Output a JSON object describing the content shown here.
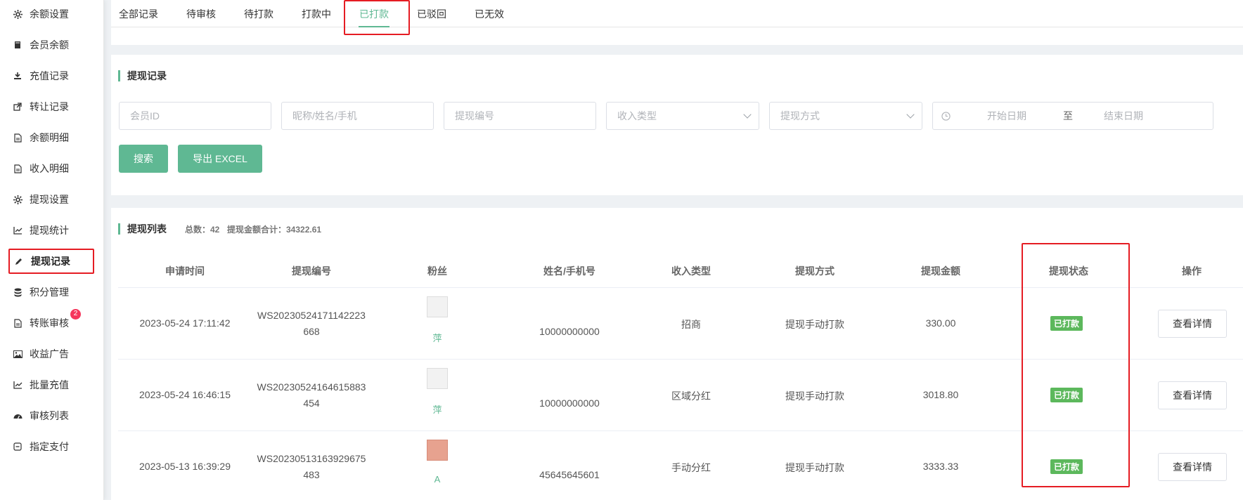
{
  "sidebar": {
    "items": [
      {
        "label": "余额设置",
        "icon": "gear-icon"
      },
      {
        "label": "会员余额",
        "icon": "book-icon"
      },
      {
        "label": "充值记录",
        "icon": "download-icon"
      },
      {
        "label": "转让记录",
        "icon": "external-link-icon"
      },
      {
        "label": "余额明细",
        "icon": "file-icon"
      },
      {
        "label": "收入明细",
        "icon": "file-icon"
      },
      {
        "label": "提现设置",
        "icon": "gear-icon"
      },
      {
        "label": "提现统计",
        "icon": "line-chart-icon"
      },
      {
        "label": "提现记录",
        "icon": "pencil-icon"
      },
      {
        "label": "积分管理",
        "icon": "database-icon"
      },
      {
        "label": "转账审核",
        "icon": "file-icon",
        "badge": "2"
      },
      {
        "label": "收益广告",
        "icon": "image-icon"
      },
      {
        "label": "批量充值",
        "icon": "line-chart-icon"
      },
      {
        "label": "审核列表",
        "icon": "dashboard-icon"
      },
      {
        "label": "指定支付",
        "icon": "minus-square-icon"
      }
    ]
  },
  "tabs": [
    "全部记录",
    "待审核",
    "待打款",
    "打款中",
    "已打款",
    "已驳回",
    "已无效"
  ],
  "filter": {
    "title": "提现记录",
    "member_id_placeholder": "会员ID",
    "nickname_placeholder": "昵称/姓名/手机",
    "withdraw_no_placeholder": "提现编号",
    "income_type_placeholder": "收入类型",
    "withdraw_method_placeholder": "提现方式",
    "start_date_placeholder": "开始日期",
    "date_separator": "至",
    "end_date_placeholder": "结束日期",
    "search_label": "搜索",
    "export_label": "导出 EXCEL"
  },
  "list": {
    "title": "提现列表",
    "total_label": "总数：42",
    "amount_label": "提现金额合计：34322.61",
    "columns": [
      "申请时间",
      "提现编号",
      "粉丝",
      "姓名/手机号",
      "收入类型",
      "提现方式",
      "提现金额",
      "提现状态",
      "操作"
    ],
    "rows": [
      {
        "time": "2023-05-24 17:11:42",
        "no_line1": "WS20230524171142223",
        "no_line2": "668",
        "fan": "萍",
        "phone": "10000000000",
        "income_type": "招商",
        "method": "提现手动打款",
        "amount": "330.00",
        "status": "已打款",
        "action": "查看详情"
      },
      {
        "time": "2023-05-24 16:46:15",
        "no_line1": "WS20230524164615883",
        "no_line2": "454",
        "fan": "萍",
        "phone": "10000000000",
        "income_type": "区域分红",
        "method": "提现手动打款",
        "amount": "3018.80",
        "status": "已打款",
        "action": "查看详情"
      },
      {
        "time": "2023-05-13 16:39:29",
        "no_line1": "WS20230513163929675",
        "no_line2": "483",
        "fan": "A",
        "phone": "45645645601",
        "income_type": "手动分红",
        "method": "提现手动打款",
        "amount": "3333.33",
        "status": "已打款",
        "action": "查看详情"
      }
    ]
  },
  "colors": {
    "accent": "#5fb893",
    "status_green": "#5cb85c",
    "highlight_red": "#e51c23"
  }
}
